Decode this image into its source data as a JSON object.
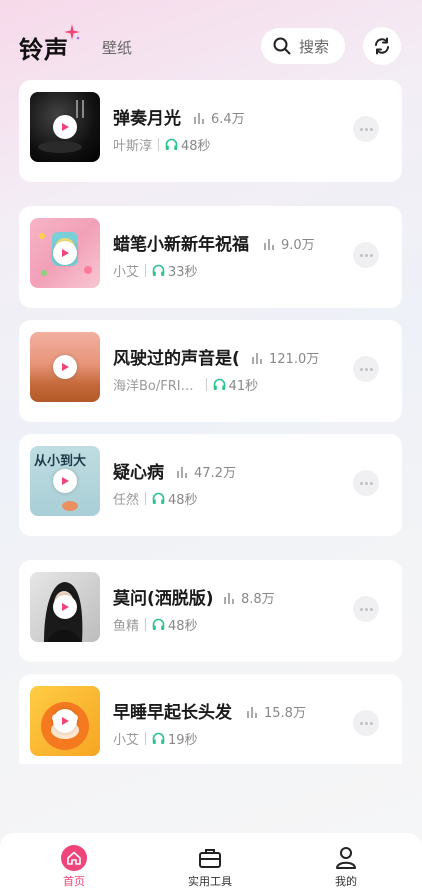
{
  "header": {
    "logo": "铃声",
    "tab_wallpaper": "壁纸",
    "search_label": "搜索",
    "accent": "#f0457a"
  },
  "ringtones": [
    {
      "title": "弹奏月光",
      "plays": "6.4万",
      "artist": "叶斯淳",
      "duration": "48秒"
    },
    {
      "title": "蜡笔小新新年祝福",
      "plays": "9.0万",
      "artist": "小艾",
      "duration": "33秒"
    },
    {
      "title": "风驶过的声音是(",
      "plays": "121.0万",
      "artist": "海洋Bo/FRI…",
      "duration": "41秒"
    },
    {
      "title": "疑心病",
      "plays": "47.2万",
      "artist": "任然",
      "duration": "48秒"
    },
    {
      "title": "莫问(洒脱版)",
      "plays": "8.8万",
      "artist": "鱼精",
      "duration": "48秒"
    },
    {
      "title": "早睡早起长头发",
      "plays": "15.8万",
      "artist": "小艾",
      "duration": "19秒"
    }
  ],
  "thumbnail_text": {
    "song3": "从小到大"
  },
  "nav": {
    "home": "首页",
    "tools": "实用工具",
    "mine": "我的"
  }
}
